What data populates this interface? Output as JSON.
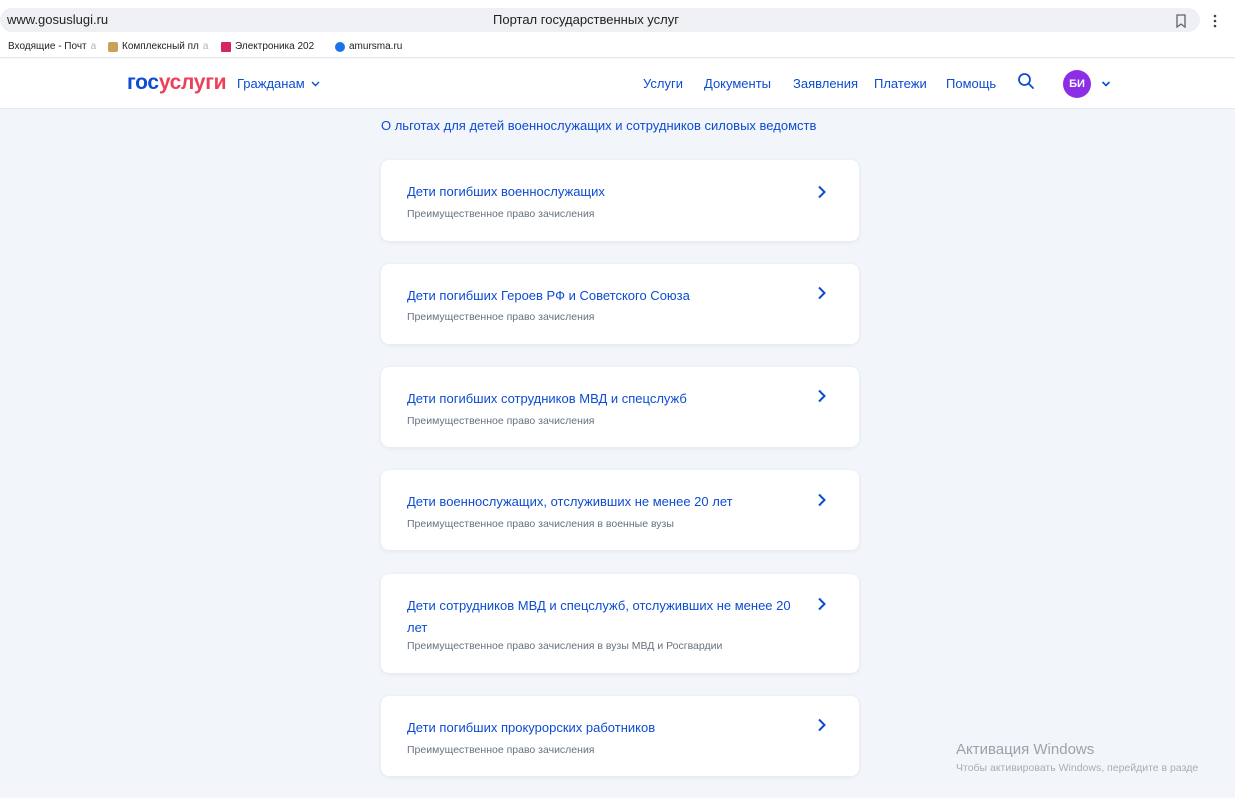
{
  "browser": {
    "url": "www.gosuslugi.ru",
    "tab_title": "Портал государственных услуг",
    "bookmarks": [
      {
        "label": "Входящие - Почта",
        "visible": "Входящие - Почт",
        "fade": "а"
      },
      {
        "label": "Комплексный пла",
        "visible": "Комплексный пл",
        "fade": "а"
      },
      {
        "label": "Электроника 202",
        "visible": "Электроника 202",
        "fade": ""
      },
      {
        "label": "amursma.ru",
        "visible": "amursma.ru",
        "fade": ""
      }
    ]
  },
  "header": {
    "logo_gos": "гос",
    "logo_uslugi": "услуги",
    "citizens_label": "Гражданам",
    "nav": [
      "Услуги",
      "Документы",
      "Заявления",
      "Платежи",
      "Помощь"
    ],
    "avatar_initials": "БИ"
  },
  "main": {
    "section_title": "О льготах для детей военнослужащих и сотрудников силовых ведомств",
    "cards": [
      {
        "title": "Дети погибших военнослужащих",
        "subtitle": "Преимущественное право зачисления"
      },
      {
        "title": "Дети погибших Героев РФ и Советского Союза",
        "subtitle": "Преимущественное право зачисления"
      },
      {
        "title": "Дети погибших сотрудников МВД и спецслужб",
        "subtitle": "Преимущественное право зачисления"
      },
      {
        "title": "Дети военнослужащих, отслуживших не менее 20 лет",
        "subtitle": "Преимущественное право зачисления в военные вузы"
      },
      {
        "title": "Дети сотрудников МВД и спецслужб, отслуживших не менее 20 лет",
        "subtitle": "Преимущественное право зачисления в вузы МВД и Росгвардии"
      },
      {
        "title": "Дети погибших прокурорских работников",
        "subtitle": "Преимущественное право зачисления"
      }
    ]
  },
  "watermark": {
    "title": "Активация Windows",
    "hint": "Чтобы активировать Windows, перейдите в разде"
  },
  "colors": {
    "accent": "#0d4cd3",
    "brand_red": "#ee3f58",
    "avatar": "#8b2ee6",
    "background": "#f2f5f9"
  }
}
